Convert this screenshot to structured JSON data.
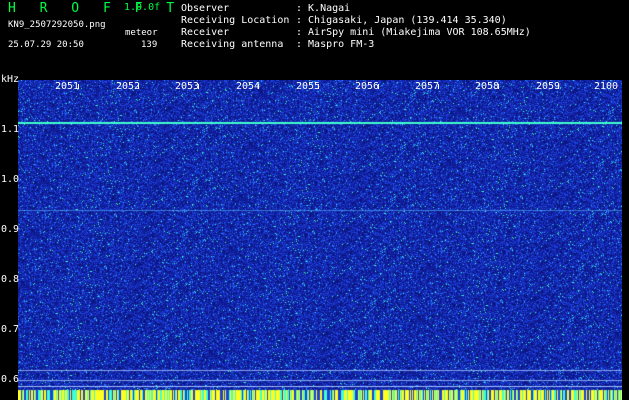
{
  "header": {
    "app_title": "H R O F F T",
    "version": "1.0.0f",
    "filename": "KN9_2507292050.png",
    "datetime": "25.07.29 20:50",
    "mode": "meteor",
    "count": "139"
  },
  "info": [
    {
      "label": "Observer",
      "value": ": K.Nagai"
    },
    {
      "label": "Receiving Location",
      "value": ": Chigasaki, Japan (139.414 35.340)"
    },
    {
      "label": "Receiver",
      "value": ": AirSpy mini (Miakejima VOR 108.65MHz)"
    },
    {
      "label": "Receiving antenna",
      "value": ": Maspro FM-3"
    }
  ],
  "axis": {
    "unit": "kHz",
    "y_labels": [
      "1.1",
      "1.0",
      "0.9",
      "0.8",
      "0.7",
      "0.6"
    ],
    "y_values": [
      1.1,
      1.0,
      0.9,
      0.8,
      0.7,
      0.6
    ],
    "x_labels": [
      "2051",
      "2052",
      "2053",
      "2054",
      "2055",
      "2056",
      "2057",
      "2058",
      "2059",
      "2100"
    ]
  },
  "colors": {
    "background": "#000000",
    "waterfall_base": "#1a2bb0",
    "signal_line": "#40ffd0",
    "bottom_band": "#ffff20",
    "title": "#00ff44"
  }
}
